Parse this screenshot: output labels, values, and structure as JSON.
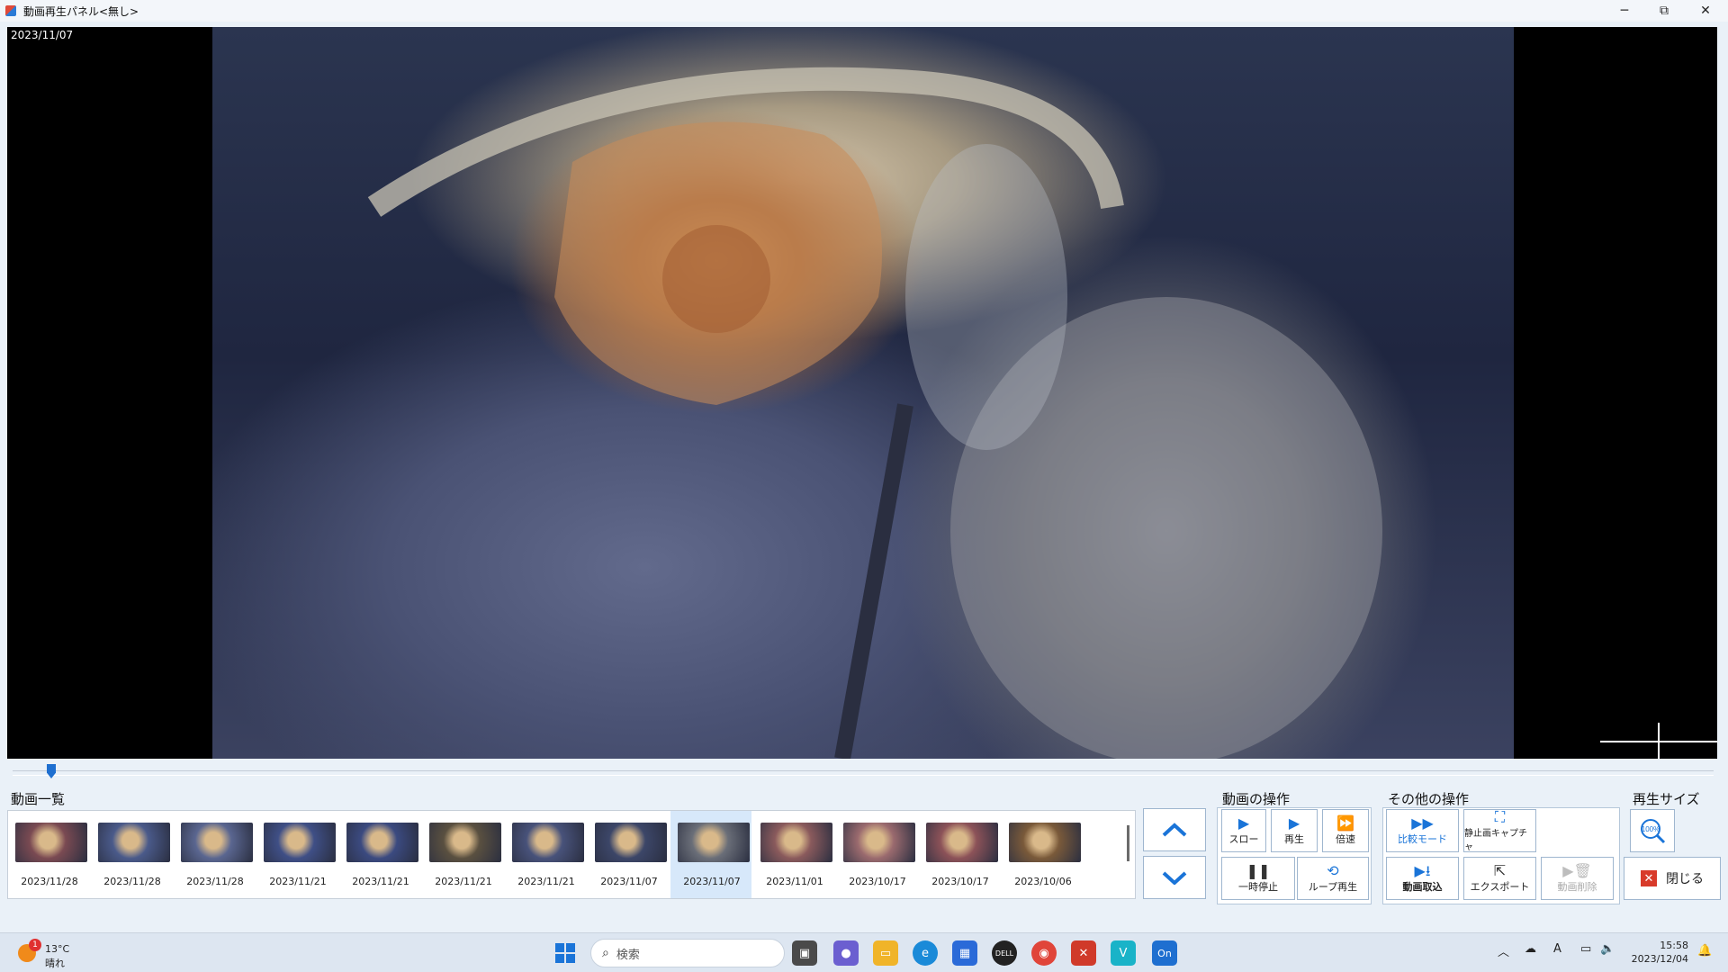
{
  "window": {
    "title": "動画再生パネル<無し>",
    "minimize": "─",
    "maximize": "⧉",
    "close": "✕"
  },
  "video": {
    "date": "2023/11/07",
    "progress": 0.02
  },
  "list": {
    "label": "動画一覧",
    "items": [
      {
        "date": "2023/11/28",
        "color": "#7a4a52",
        "selected": false
      },
      {
        "date": "2023/11/28",
        "color": "#4a5a8a",
        "selected": false
      },
      {
        "date": "2023/11/28",
        "color": "#5a6690",
        "selected": false
      },
      {
        "date": "2023/11/21",
        "color": "#3f4f86",
        "selected": false
      },
      {
        "date": "2023/11/21",
        "color": "#3b4a80",
        "selected": false
      },
      {
        "date": "2023/11/21",
        "color": "#5a5040",
        "selected": false
      },
      {
        "date": "2023/11/21",
        "color": "#48527a",
        "selected": false
      },
      {
        "date": "2023/11/07",
        "color": "#3c4668",
        "selected": false
      },
      {
        "date": "2023/11/07",
        "color": "#6a6e78",
        "selected": true
      },
      {
        "date": "2023/11/01",
        "color": "#8a5a5c",
        "selected": false
      },
      {
        "date": "2023/10/17",
        "color": "#9a6a6e",
        "selected": false
      },
      {
        "date": "2023/10/17",
        "color": "#8c5258",
        "selected": false
      },
      {
        "date": "2023/10/06",
        "color": "#7a5a3a",
        "selected": false
      }
    ],
    "up": "︿",
    "down": "﹀"
  },
  "video_ops": {
    "label": "動画の操作",
    "slow": "スロー",
    "play": "再生",
    "fast": "倍速",
    "pause": "一時停止",
    "loop": "ループ再生"
  },
  "other_ops": {
    "label": "その他の操作",
    "compare": "比較モード",
    "capture": "静止画キャプチャ",
    "import": "動画取込",
    "export": "エクスポート",
    "delete": "動画削除"
  },
  "size": {
    "label": "再生サイズ",
    "percent": "100%"
  },
  "close_button": {
    "label": "閉じる",
    "icon": "✕"
  },
  "taskbar": {
    "weather_temp": "13°C",
    "weather_desc": "晴れ",
    "badge": "1",
    "search_placeholder": "検索",
    "clock_time": "15:58",
    "clock_date": "2023/12/04",
    "ime": "A",
    "apps": [
      "windows-start",
      "search",
      "task-view",
      "teams-chat",
      "file-explorer",
      "edge",
      "store",
      "dell",
      "chrome",
      "x-app",
      "v-app",
      "on-app"
    ]
  }
}
